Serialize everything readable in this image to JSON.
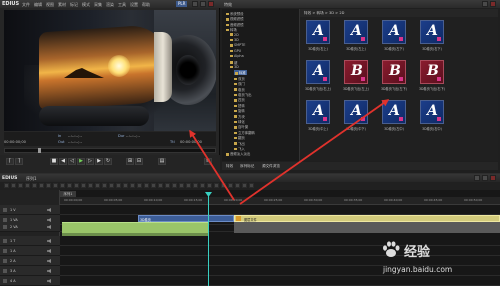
{
  "app": {
    "logo": "EDIUS",
    "menus": [
      "文件",
      "编辑",
      "视图",
      "素材",
      "标记",
      "模式",
      "采集",
      "渲染",
      "工具",
      "设置",
      "帮助"
    ],
    "player_badge": "PLR"
  },
  "player": {
    "timecode_current": "00:00:00;00",
    "in_label": "In",
    "in_value": "--:--:--;--",
    "out_label": "Out",
    "out_value": "--:--:--;--",
    "dur_label": "Dur",
    "dur_value": "--:--:--;--",
    "ttl_label": "Ttl",
    "ttl_value": "00:00:00;00"
  },
  "effects": {
    "title": "特效",
    "path": "特效 > 转场 > 3D > 2D",
    "tree": [
      "系统预设",
      "视频滤镜",
      "音频滤镜",
      "转场",
      "2D",
      "3D",
      "SMPTE",
      "GPU",
      "Alpha",
      "键",
      "3D",
      "标准",
      "双页",
      "双门",
      "卷页",
      "卷页飞出",
      "四页",
      "扭转",
      "旋转",
      "方块",
      "球化",
      "百叶窗",
      "立方体翻转",
      "翻页",
      "飞出",
      "飞入",
      "音频淡入淡出"
    ],
    "selected_index": 11,
    "tiles": [
      {
        "letter": "A",
        "label": "3D卷页(右上)",
        "red": false
      },
      {
        "letter": "A",
        "label": "3D卷页(左上)",
        "red": false
      },
      {
        "letter": "A",
        "label": "3D卷页(左下)",
        "red": false
      },
      {
        "letter": "A",
        "label": "3D卷页(右下)",
        "red": false
      },
      {
        "letter": "A",
        "label": "3D卷页飞出(右上)",
        "red": false
      },
      {
        "letter": "B",
        "label": "3D卷页飞出(左上)",
        "red": true
      },
      {
        "letter": "B",
        "label": "3D卷页飞出(左下)",
        "red": true
      },
      {
        "letter": "B",
        "label": "3D卷页飞出(右下)",
        "red": true
      },
      {
        "letter": "A",
        "label": "3D卷页(中上)",
        "red": false
      },
      {
        "letter": "A",
        "label": "3D卷页(中下)",
        "red": false
      },
      {
        "letter": "A",
        "label": "3D卷页(左中)",
        "red": false
      },
      {
        "letter": "A",
        "label": "3D卷页(右中)",
        "red": false
      }
    ],
    "bottom_tabs": [
      "特效",
      "序列标记",
      "源文件浏览"
    ]
  },
  "timeline": {
    "logo": "EDIUS",
    "sequence": "序列1",
    "tab": "序列1",
    "ruler": [
      "00:00:00;00",
      "00:00:05;00",
      "00:00:10;00",
      "00:00:15;00",
      "00:00:20;00",
      "00:00:25;00",
      "00:00:30;00",
      "00:00:35;00",
      "00:00:40;00",
      "00:00:45;00",
      "00:00:50;00"
    ],
    "tracks": [
      "1 V",
      "1 VA",
      "2 VA",
      "1 T",
      "1 A",
      "2 A",
      "3 A",
      "4 A"
    ],
    "clip_a": "3D卷页",
    "clip_b": "图层文件"
  },
  "watermark": {
    "brand": "经验",
    "url": "jingyan.baidu.com"
  },
  "colors": {
    "accent": "#3f5f96",
    "playhead": "#39d0c2",
    "annotation_arrow": "#e0322c"
  }
}
